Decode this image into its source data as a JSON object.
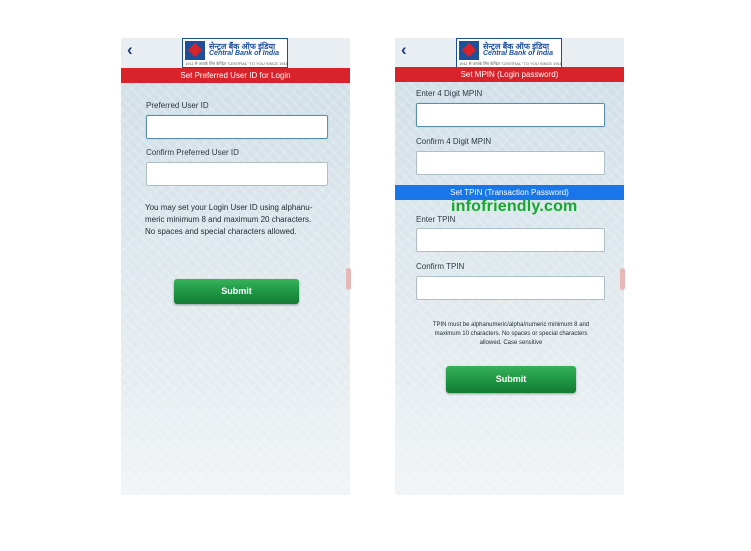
{
  "watermark": "infofriendly.com",
  "bank": {
    "name_hindi": "सेन्ट्रल बैंक ऑफ इंडिया",
    "name_en": "Central Bank of India",
    "tagline": "1911 से आपके लिए केन्द्रित \"CENTRAL\" TO YOU SINCE 1911"
  },
  "screen1": {
    "back_icon": "chevron-left-icon",
    "header": "Set Preferred User ID for Login",
    "field1_label": "Preferred User ID",
    "field1_value": "",
    "field2_label": "Confirm Preferred User ID",
    "field2_value": "",
    "note_line1": "You may set your Login User ID using alphanu-",
    "note_line2": "meric minimum 8 and maximum 20 characters.",
    "note_line3": "No spaces and special characters allowed.",
    "submit": "Submit"
  },
  "screen2": {
    "back_icon": "chevron-left-icon",
    "header_mpin": "Set MPIN (Login password)",
    "mpin_label": "Enter 4 Digit MPIN",
    "mpin_value": "",
    "mpin_confirm_label": "Confirm 4 Digit MPIN",
    "mpin_confirm_value": "",
    "header_tpin": "Set TPIN (Transaction Password)",
    "tpin_label": "Enter TPIN",
    "tpin_value": "",
    "tpin_confirm_label": "Confirm TPIN",
    "tpin_confirm_value": "",
    "note_line1": "TPIN must be alphanumeric/alpha/numeric minimum 8 and",
    "note_line2": "maximum 10 characters. No spaces or special characters",
    "note_line3": "allowed. Case sensitive",
    "submit": "Submit"
  },
  "colors": {
    "header_red": "#d8232a",
    "header_blue": "#1976e8",
    "button_green": "#1e9744",
    "watermark_green": "#14a82c"
  }
}
